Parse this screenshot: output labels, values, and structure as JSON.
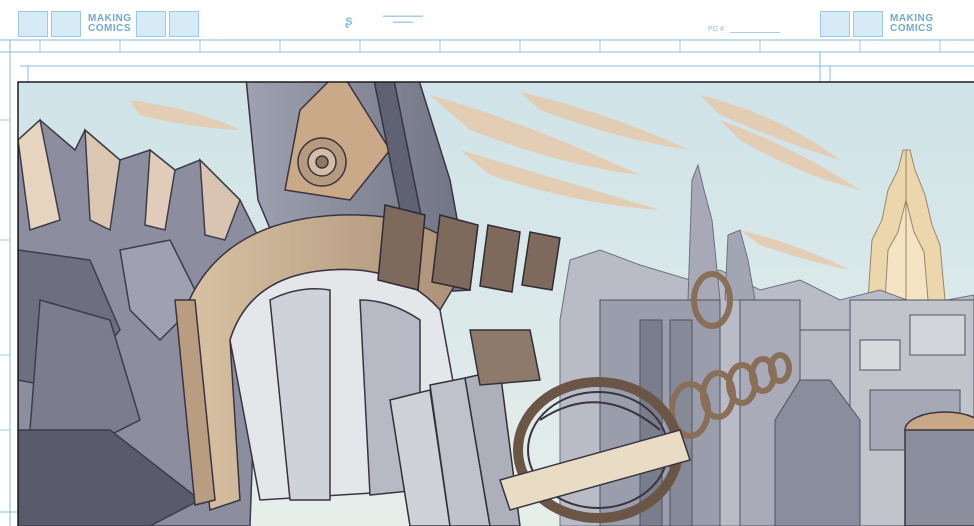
{
  "template": {
    "logo_left_line1": "MAKING",
    "logo_left_line2": "COMICS",
    "logo_right_line1": "MAKING",
    "logo_right_line2": "COMICS",
    "page_number_label": "PG #"
  },
  "colors": {
    "guide_blue": "#7fb6de",
    "sky": "#d6e7ea",
    "cloud": "#e4c7a9",
    "stone": "#8f93a3",
    "stone_dark": "#5d6070",
    "tan": "#c8a886",
    "gold_spire": "#e8d2a8",
    "ink": "#3a3440"
  }
}
